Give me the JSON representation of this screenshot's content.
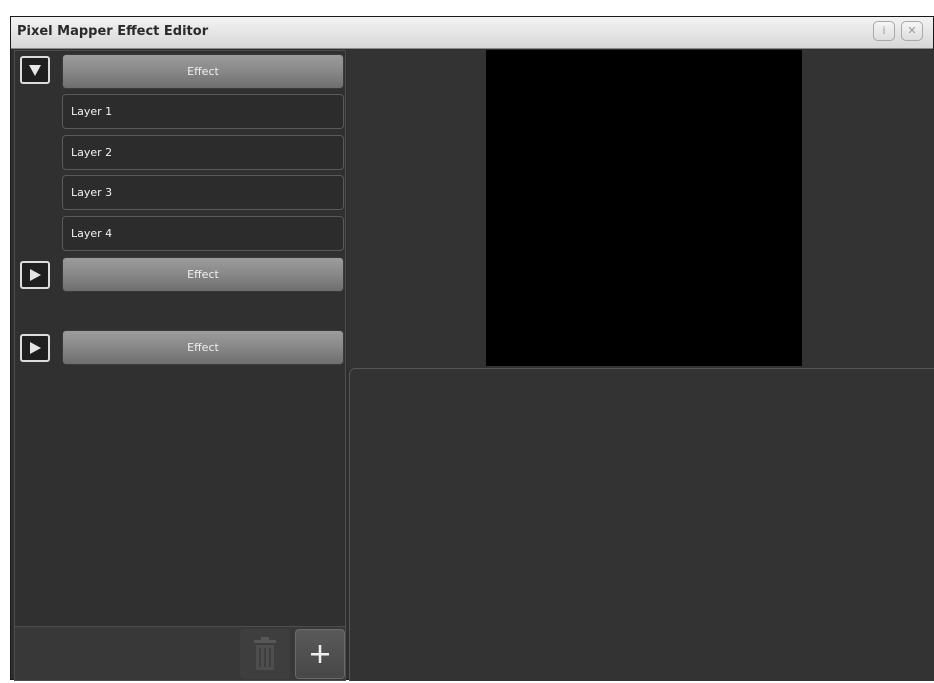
{
  "window": {
    "title": "Pixel Mapper Effect Editor",
    "info_button": "i",
    "close_button": "✕"
  },
  "tree": {
    "groups": [
      {
        "expanded": true,
        "label": "Effect",
        "layers": [
          {
            "label": "Layer 1"
          },
          {
            "label": "Layer 2"
          },
          {
            "label": "Layer 3"
          },
          {
            "label": "Layer 4"
          }
        ]
      },
      {
        "expanded": false,
        "label": "Effect",
        "layers": []
      },
      {
        "expanded": false,
        "label": "Effect",
        "layers": []
      }
    ]
  },
  "toolbar": {
    "delete_icon": "trash-icon",
    "add_icon": "plus-icon"
  },
  "colors": {
    "window_bg": "#2e2e2e",
    "titlebar_top": "#f3f3f3",
    "titlebar_bottom": "#d7d7d7",
    "effect_button": "#8a8a8a",
    "preview_bg": "#000000"
  }
}
